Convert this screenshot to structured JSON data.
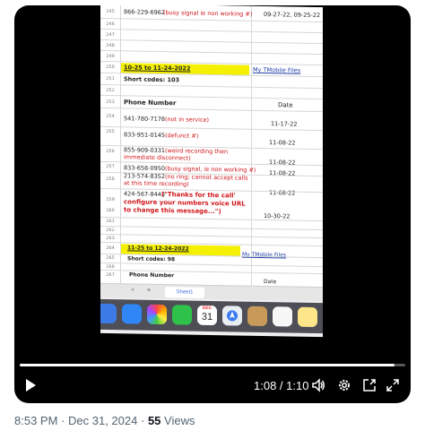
{
  "video": {
    "current_time": "1:08",
    "duration": "1:10",
    "progress_fraction": 0.971
  },
  "spreadsheet": {
    "rows": [
      {
        "num": "245",
        "a": "866-229-6962",
        "a_note": "(busy signal ie non working #)",
        "b": "09-27-22, 09-25-22"
      },
      {
        "num": "246"
      },
      {
        "num": "247"
      },
      {
        "num": "248"
      },
      {
        "num": "249"
      },
      {
        "num": "250",
        "a": "10-25 to 11-24-2022",
        "b": "My TMobile Files"
      },
      {
        "num": "251",
        "a": "Short codes: 103"
      },
      {
        "num": "252"
      },
      {
        "num": "253",
        "a": "Phone Number",
        "b": "Date"
      },
      {
        "num": "254",
        "a": "541-780-7178",
        "a_note": "(not in service)",
        "b": "11-17-22"
      },
      {
        "num": "255",
        "a": "833-951-0145",
        "a_note": "(defunct #)",
        "b": "11-08-22"
      },
      {
        "num": "256",
        "a": "855-909-0331",
        "a_note": "(weird recording then immediate disconnect)",
        "b": "11-08-22"
      },
      {
        "num": "257",
        "a": "833-658-0950",
        "a_note": "(busy signal, ie non working #)",
        "b": "11-08-22"
      },
      {
        "num": "258",
        "a": "213-574-8352",
        "a_note": "(no ring; cannot accept calls at this time recording)",
        "b": "11-08-22"
      },
      {
        "num": "259",
        "a": "424-567-8443",
        "a_note": "(\"Thanks for the call' configure your numbers voice URL to change this message...\")",
        "b": "10-30-22"
      },
      {
        "num": "260"
      },
      {
        "num": "261"
      },
      {
        "num": "262"
      },
      {
        "num": "263"
      },
      {
        "num": "264",
        "a": "11-25 to 12-24-2022",
        "b": "My TMobile Files"
      },
      {
        "num": "265",
        "a": "Short codes: 98"
      },
      {
        "num": "266"
      },
      {
        "num": "267",
        "a": "Phone Number",
        "b": "Date"
      }
    ],
    "sheet_tab": "Sheet1",
    "add_sheet_glyph": "+",
    "list_glyph": "≡"
  },
  "dock": {
    "calendar_month": "DEC",
    "calendar_day": "31"
  },
  "tweet_meta": {
    "time": "8:53 PM",
    "date": "Dec 31, 2024",
    "separator": "·",
    "view_count": "55",
    "views_label": "Views"
  },
  "icons": {
    "play": "play-icon",
    "volume": "volume-icon",
    "settings": "gear-icon",
    "pip": "picture-in-picture-icon",
    "fullscreen": "fullscreen-icon"
  },
  "colors": {
    "highlight": "#f5f000",
    "note_red": "#d0161b",
    "link_blue": "#1f3ea8"
  }
}
